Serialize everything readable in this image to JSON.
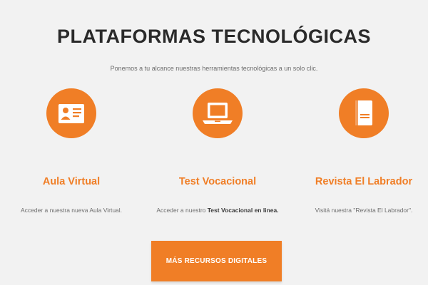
{
  "section": {
    "title": "PLATAFORMAS TECNOLÓGICAS",
    "subtitle": "Ponemos a tu alcance nuestras herramientas tecnológicas a un solo clic."
  },
  "cards": [
    {
      "icon": "id-card-icon",
      "title": "Aula Virtual",
      "desc_prefix": "Acceder a nuestra nueva Aula Virtual."
    },
    {
      "icon": "laptop-icon",
      "title": "Test Vocacional",
      "desc_prefix": "Acceder a nuestro ",
      "desc_bold": "Test Vocacional en linea."
    },
    {
      "icon": "book-icon",
      "title": "Revista El Labrador",
      "desc_prefix": "Visitá nuestra \"Revista El Labrador\"."
    }
  ],
  "cta": {
    "label": "MÁS RECURSOS DIGITALES"
  },
  "colors": {
    "accent": "#f07e26",
    "background": "#f2f2f2",
    "title": "#2a2a2a",
    "muted": "#6d6d6d"
  }
}
